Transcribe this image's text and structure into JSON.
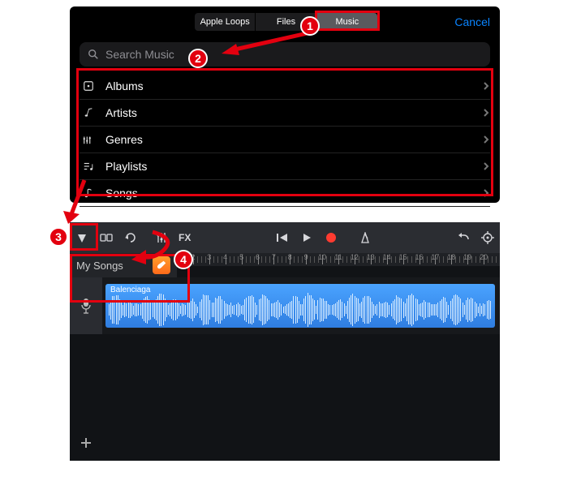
{
  "top": {
    "tabs": {
      "loops": "Apple Loops",
      "files": "Files",
      "music": "Music"
    },
    "cancel": "Cancel",
    "search_placeholder": "Search Music",
    "rows": [
      {
        "icon": "albums-icon",
        "label": "Albums"
      },
      {
        "icon": "artists-icon",
        "label": "Artists"
      },
      {
        "icon": "genres-icon",
        "label": "Genres"
      },
      {
        "icon": "playlists-icon",
        "label": "Playlists"
      },
      {
        "icon": "songs-icon",
        "label": "Songs"
      }
    ]
  },
  "toolbar": {
    "fx_label": "FX"
  },
  "song": {
    "my_songs": "My Songs"
  },
  "clip": {
    "name": "Balenciaga"
  },
  "ruler": {
    "start": 1,
    "count": 20
  },
  "annotations": [
    "1",
    "2",
    "3",
    "4"
  ]
}
